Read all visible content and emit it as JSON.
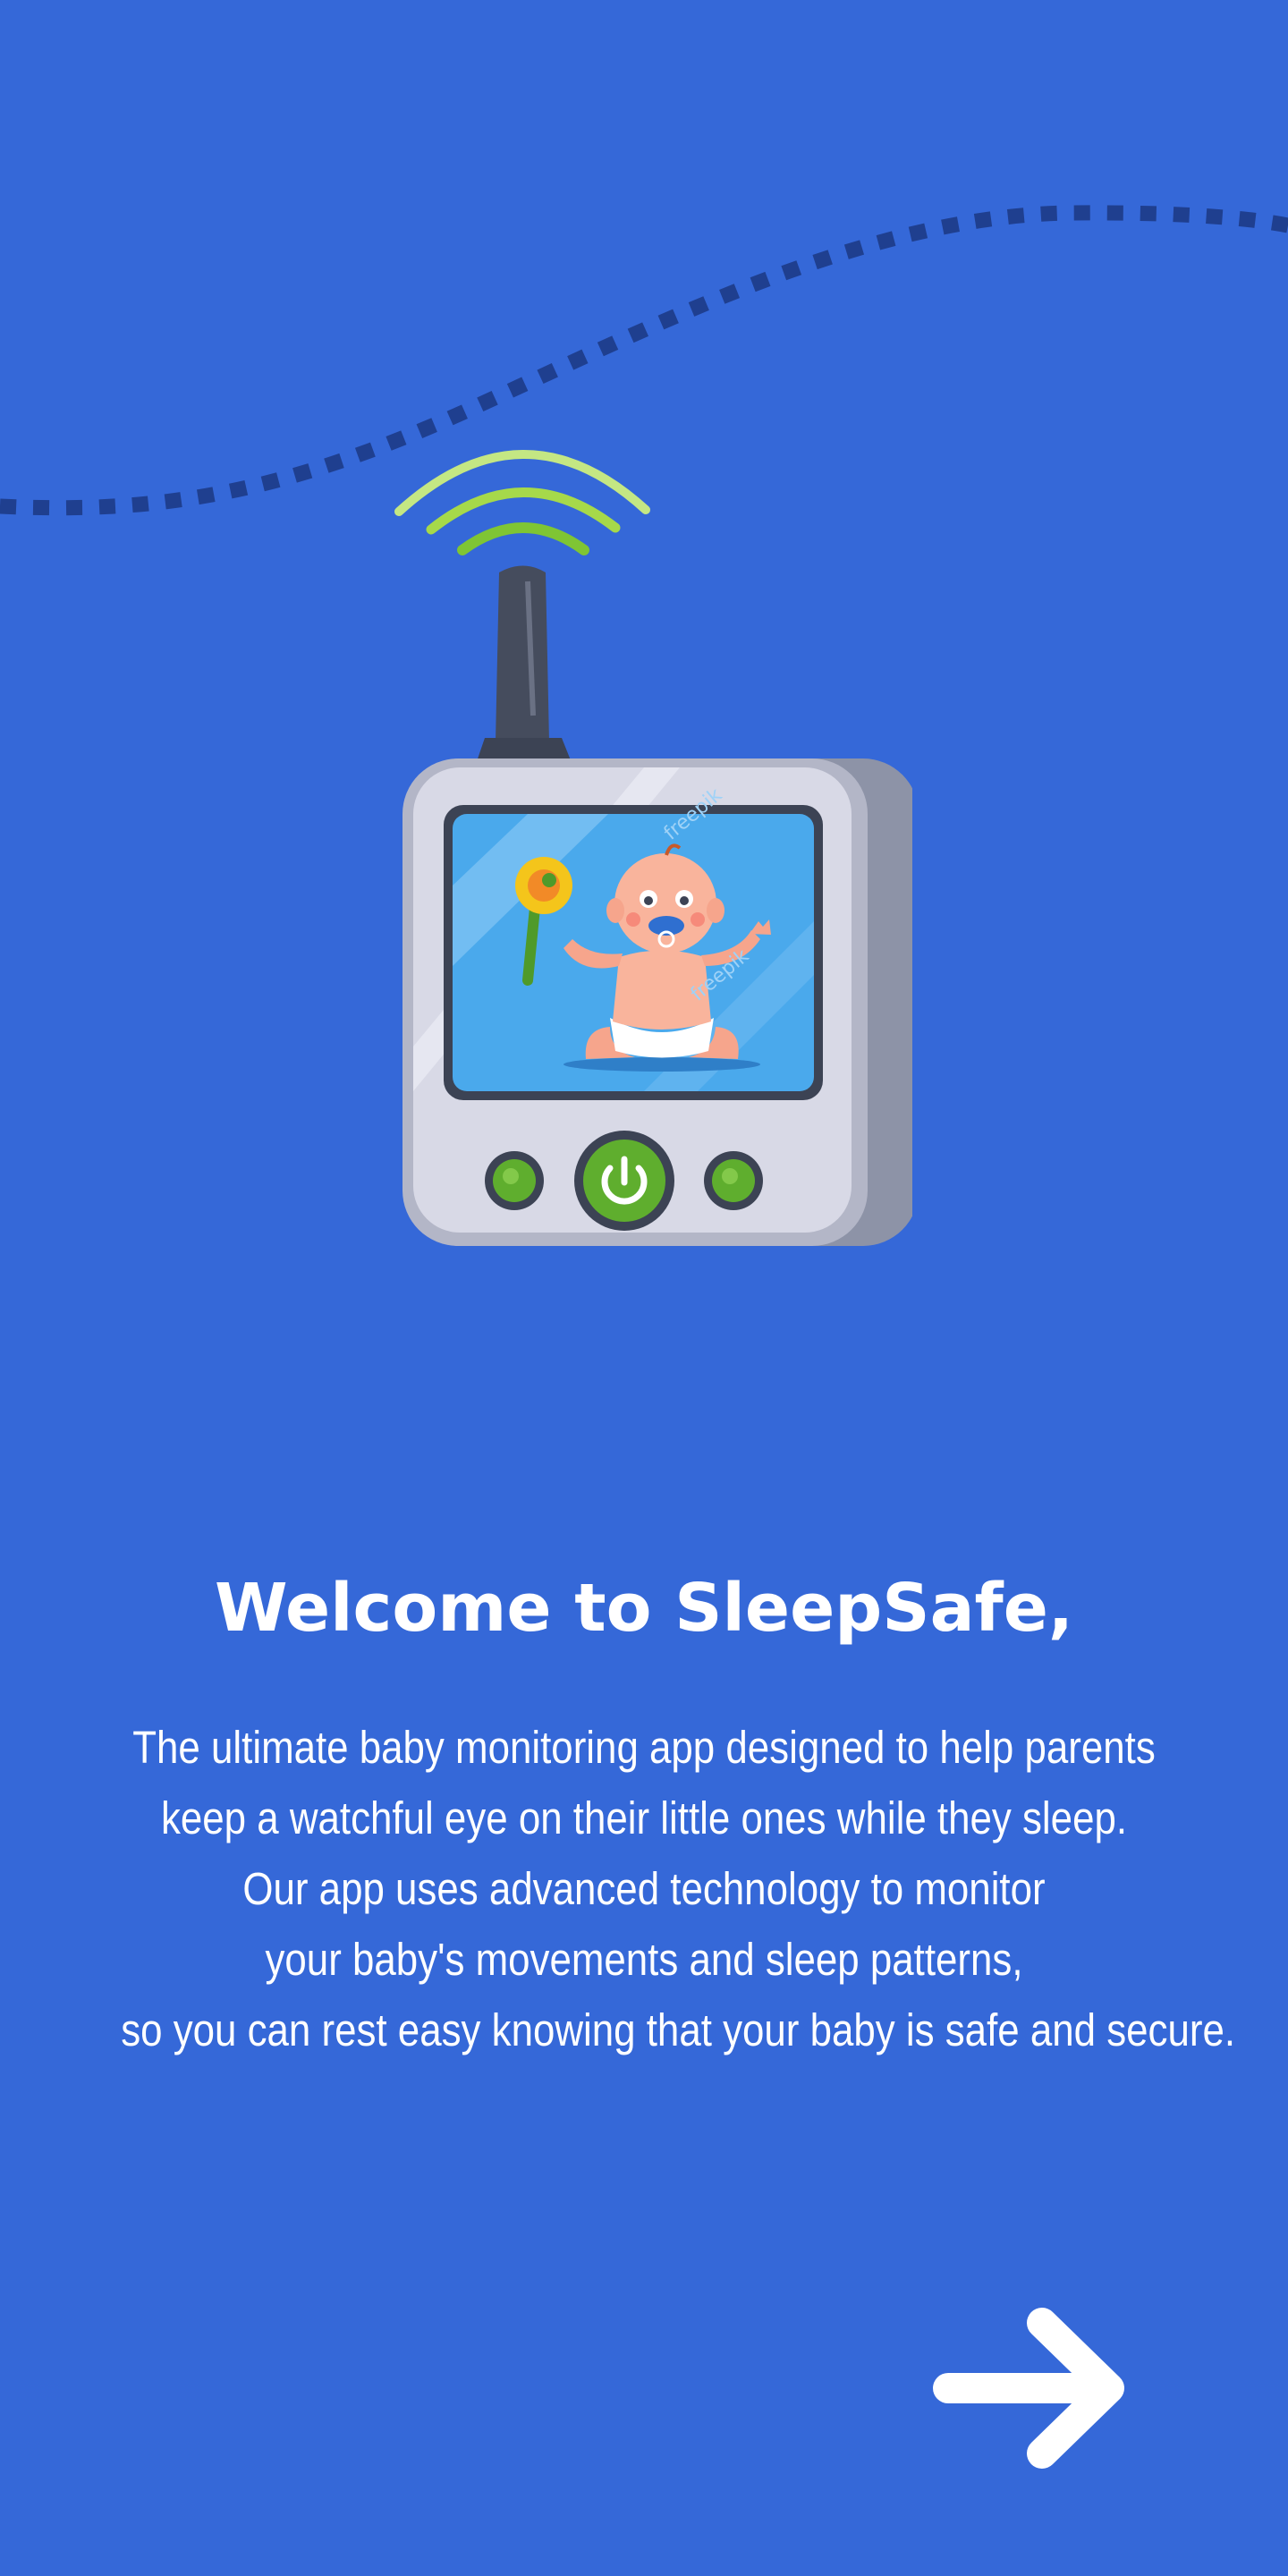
{
  "welcome": {
    "title": "Welcome to SleepSafe,",
    "description_lines": [
      "The ultimate baby monitoring app designed to help parents",
      "keep a watchful eye on their little ones while they sleep.",
      "Our app uses advanced technology to monitor",
      "your baby's movements and sleep patterns,",
      "so you can rest easy knowing that your baby is safe and secure."
    ]
  },
  "illustration": {
    "watermark": "freepik"
  },
  "navigation": {
    "next_icon": "arrow-right-icon"
  },
  "colors": {
    "background": "#3568d8",
    "text": "#ffffff",
    "dash_line": "#1f3f8f",
    "device_body": "#d8d9e6",
    "screen": "#4aa9ec",
    "button_green": "#5fae2e",
    "signal_green": "#a6d94a"
  }
}
